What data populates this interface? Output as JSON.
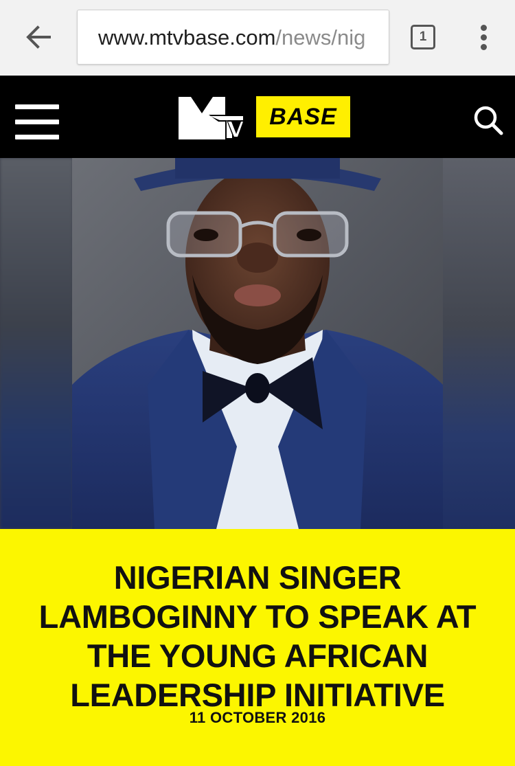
{
  "browser": {
    "url_host": "www.mtvbase.com",
    "url_path": "/news/nig",
    "tab_count": "1",
    "icons": {
      "back": "arrow-left-icon",
      "tabs": "tab-switcher-icon",
      "menu": "kebab-menu-icon"
    }
  },
  "site": {
    "logo_mtv": "MTV",
    "logo_base": "BASE",
    "accent_color": "#fcf600",
    "header_color": "#000000",
    "icons": {
      "menu": "hamburger-icon",
      "search": "search-icon"
    }
  },
  "article": {
    "headline": "NIGERIAN SINGER LAMBOGINNY TO SPEAK AT THE YOUNG AFRICAN LEADERSHIP INITIATIVE",
    "date": "11 OCTOBER 2016"
  }
}
